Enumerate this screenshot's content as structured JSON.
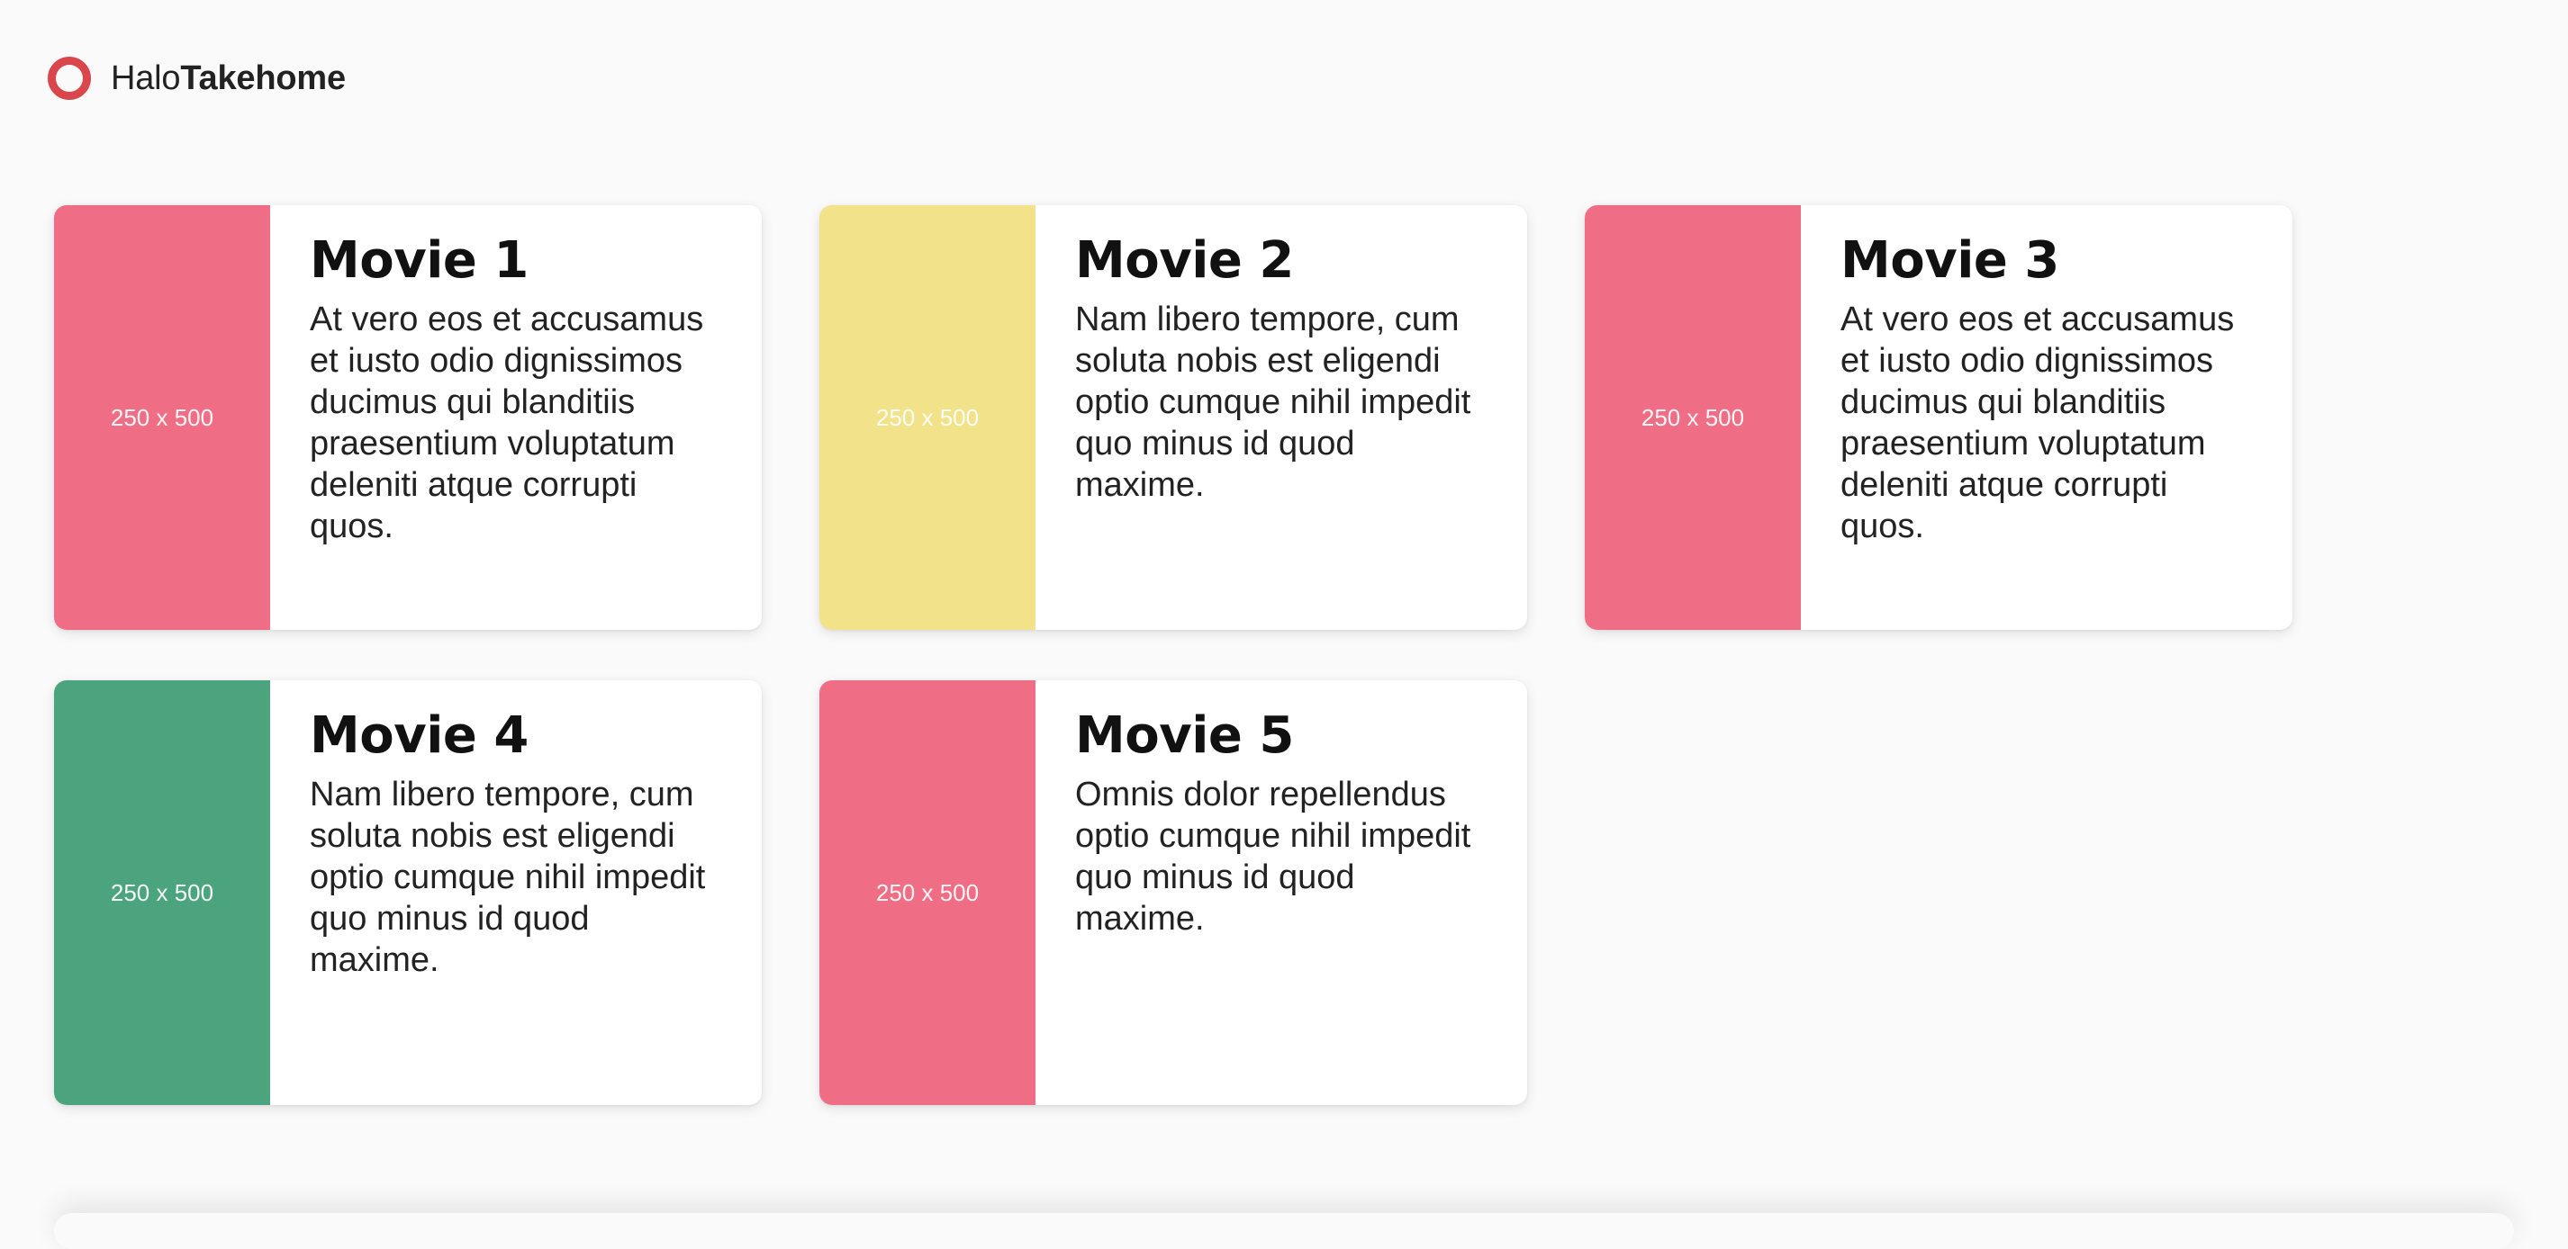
{
  "header": {
    "brand_regular": "Halo",
    "brand_bold": "Takehome"
  },
  "colors": {
    "brand": "#d9464b",
    "pink": "#ef6e86",
    "yellow": "#f2e28a",
    "green": "#4ca47f"
  },
  "movies": [
    {
      "title": "Movie 1",
      "description": "At vero eos et accusamus et iusto odio dignissimos ducimus qui blanditiis praesentium voluptatum deleniti atque corrupti quos.",
      "poster_label": "250 x 500",
      "poster_color": "#ef6e86"
    },
    {
      "title": "Movie 2",
      "description": "Nam libero tempore, cum soluta nobis est eligendi optio cumque nihil impedit quo minus id quod maxime.",
      "poster_label": "250 x 500",
      "poster_color": "#f2e28a"
    },
    {
      "title": "Movie 3",
      "description": "At vero eos et accusamus et iusto odio dignissimos ducimus qui blanditiis praesentium voluptatum deleniti atque corrupti quos.",
      "poster_label": "250 x 500",
      "poster_color": "#ef6e86"
    },
    {
      "title": "Movie 4",
      "description": "Nam libero tempore, cum soluta nobis est eligendi optio cumque nihil impedit quo minus id quod maxime.",
      "poster_label": "250 x 500",
      "poster_color": "#4ca47f"
    },
    {
      "title": "Movie 5",
      "description": "Omnis dolor repellendus optio cumque nihil impedit quo minus id quod maxime.",
      "poster_label": "250 x 500",
      "poster_color": "#ef6e86"
    }
  ]
}
